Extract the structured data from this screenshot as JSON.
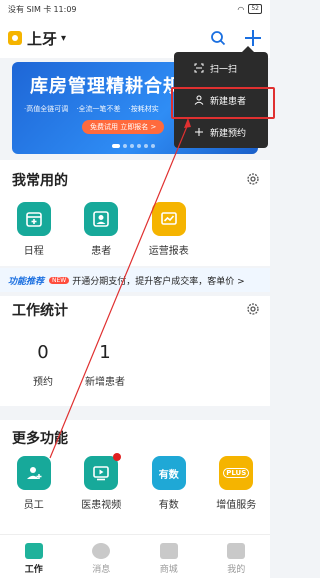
{
  "status": {
    "carrier": "没有 SIM 卡",
    "time": "11:09",
    "battery": "52"
  },
  "header": {
    "clinic_name": "上牙",
    "search_icon": "search-icon",
    "add_icon": "plus-icon"
  },
  "banner": {
    "title": "库房管理精耕合规,上",
    "tags": [
      "·高值全链可调",
      "·全流一笔不差",
      "·按耗材实"
    ],
    "cta": "免费试用 立即报名 >"
  },
  "favorites": {
    "title": "我常用的",
    "items": [
      {
        "label": "日程",
        "icon": "calendar-icon",
        "color": "#17a99a"
      },
      {
        "label": "患者",
        "icon": "patient-icon",
        "color": "#17a99a"
      },
      {
        "label": "运营报表",
        "icon": "report-icon",
        "color": "#f5b400"
      }
    ]
  },
  "promo": {
    "tag": "功能推荐",
    "badge": "NEW",
    "text": "开通分期支付，提升客户成交率，客单价 >"
  },
  "stats": {
    "title": "工作统计",
    "items": [
      {
        "value": "0",
        "label": "预约"
      },
      {
        "value": "1",
        "label": "新增患者"
      }
    ]
  },
  "more": {
    "title": "更多功能",
    "items": [
      {
        "label": "员工",
        "icon": "staff-icon",
        "color": "#17a99a"
      },
      {
        "label": "医患视频",
        "icon": "video-icon",
        "color": "#17a99a"
      },
      {
        "label": "有数",
        "icon": "youshu-icon",
        "color": "#1fa8d6",
        "text": "有数"
      },
      {
        "label": "增值服务",
        "icon": "plus-service-icon",
        "color": "#f5b400",
        "text": "PLUS"
      }
    ]
  },
  "tabbar": {
    "items": [
      {
        "label": "工作",
        "icon": "work-icon",
        "active": true
      },
      {
        "label": "消息",
        "icon": "message-icon",
        "active": false
      },
      {
        "label": "商城",
        "icon": "store-icon",
        "active": false
      },
      {
        "label": "我的",
        "icon": "profile-icon",
        "active": false
      }
    ]
  },
  "popup_menu": {
    "items": [
      {
        "label": "扫一扫",
        "icon": "scan-icon"
      },
      {
        "label": "新建患者",
        "icon": "user-icon",
        "highlighted": true
      },
      {
        "label": "新建预约",
        "icon": "plus-icon"
      }
    ]
  }
}
